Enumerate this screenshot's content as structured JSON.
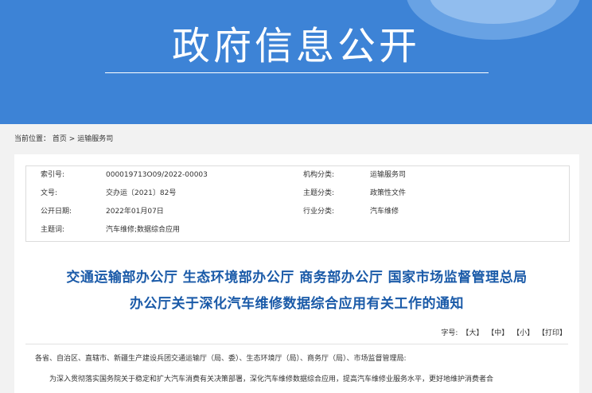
{
  "banner": {
    "title": "政府信息公开"
  },
  "breadcrumb": {
    "label": "当前位置：",
    "home": "首页",
    "sep": ">",
    "current": "运输服务司"
  },
  "meta": {
    "index_label": "索引号:",
    "index_value": "000019713O09/2022-00003",
    "org_label": "机构分类:",
    "org_value": "运输服务司",
    "doc_label": "文号:",
    "doc_value": "交办运〔2021〕82号",
    "topic_label": "主题分类:",
    "topic_value": "政策性文件",
    "date_label": "公开日期:",
    "date_value": "2022年01月07日",
    "industry_label": "行业分类:",
    "industry_value": "汽车维修",
    "keyword_label": "主题词:",
    "keyword_value": "汽车维修;数据综合应用"
  },
  "article": {
    "title_line1": "交通运输部办公厅 生态环境部办公厅 商务部办公厅 国家市场监督管理总局",
    "title_line2": "办公厅关于深化汽车维修数据综合应用有关工作的通知",
    "font_label": "字号:",
    "font_large": "【大】",
    "font_medium": "【中】",
    "font_small": "【小】",
    "print": "【打印】",
    "salutation": "各省、自治区、直辖市、新疆生产建设兵团交通运输厅（局、委）、生态环境厅（局）、商务厅（局）、市场监督管理局:",
    "body_line1": "为深入贯彻落实国务院关于稳定和扩大汽车消费有关决策部署，深化汽车维修数据综合应用，提高汽车维修业服务水平，更好地维护消费者合"
  }
}
